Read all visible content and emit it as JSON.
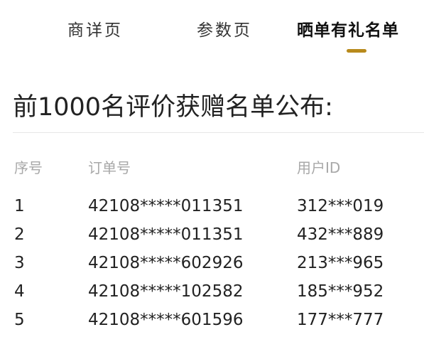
{
  "tabs": [
    {
      "label": "商详页"
    },
    {
      "label": "参数页"
    },
    {
      "label": "晒单有礼名单"
    }
  ],
  "active_tab_index": 2,
  "colors": {
    "accent": "#b88a1c",
    "header_text": "#a8a8a8",
    "body_text": "#222222"
  },
  "page_title": "前1000名评价获赠名单公布:",
  "table": {
    "headers": [
      "序号",
      "订单号",
      "用户ID"
    ],
    "rows": [
      [
        "1",
        "42108*****011351",
        "312***019"
      ],
      [
        "2",
        "42108*****011351",
        "432***889"
      ],
      [
        "3",
        "42108*****602926",
        "213***965"
      ],
      [
        "4",
        "42108*****102582",
        "185***952"
      ],
      [
        "5",
        "42108*****601596",
        "177***777"
      ]
    ]
  }
}
